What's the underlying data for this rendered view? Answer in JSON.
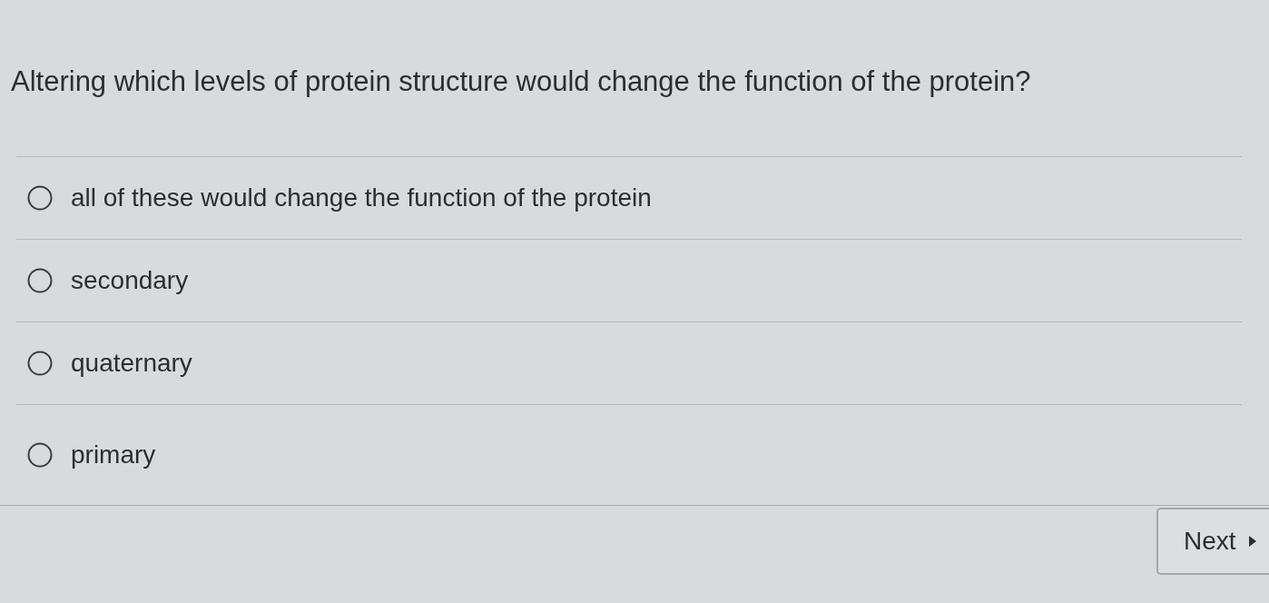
{
  "question": {
    "text": "Altering which levels of protein structure would change the function of the protein?"
  },
  "options": [
    {
      "label": "all of these would change the function of the protein",
      "selected": false
    },
    {
      "label": "secondary",
      "selected": false
    },
    {
      "label": "quaternary",
      "selected": false
    },
    {
      "label": "primary",
      "selected": false
    }
  ],
  "next_button": {
    "label": "Next"
  }
}
